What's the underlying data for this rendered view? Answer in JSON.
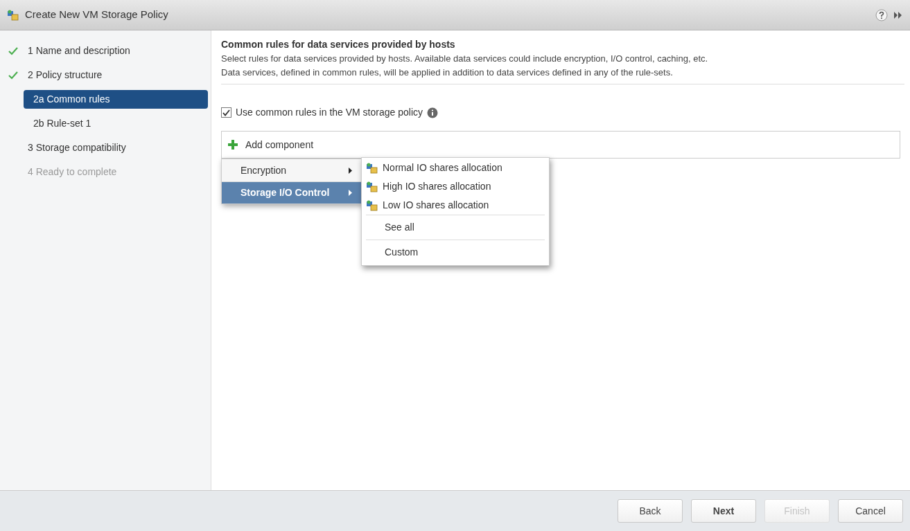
{
  "window": {
    "title": "Create New VM Storage Policy"
  },
  "steps": [
    {
      "label": "1  Name and description",
      "done": true,
      "selected": false,
      "disabled": false
    },
    {
      "label": "2  Policy structure",
      "done": true,
      "selected": false,
      "disabled": false,
      "children": [
        {
          "label": "2a  Common rules",
          "done": false,
          "selected": true,
          "disabled": false
        },
        {
          "label": "2b  Rule-set 1",
          "done": false,
          "selected": false,
          "disabled": false
        }
      ]
    },
    {
      "label": "3  Storage compatibility",
      "done": false,
      "selected": false,
      "disabled": false
    },
    {
      "label": "4  Ready to complete",
      "done": false,
      "selected": false,
      "disabled": true
    }
  ],
  "content": {
    "heading": "Common rules for data services provided by hosts",
    "description": [
      "Select rules for data services provided by hosts. Available data services could include encryption, I/O control, caching, etc.",
      "Data services, defined in common rules, will be applied in addition to data services defined in any of the rule-sets."
    ],
    "checkbox": {
      "label": "Use common rules in the VM storage policy",
      "checked": true
    },
    "add_component": "Add component"
  },
  "menu": [
    {
      "label": "Encryption",
      "selected": false
    },
    {
      "label": "Storage I/O Control",
      "selected": true
    }
  ],
  "submenu": [
    {
      "label": "Normal IO shares allocation",
      "kind": "icon"
    },
    {
      "label": "High IO shares allocation",
      "kind": "icon"
    },
    {
      "label": "Low IO shares allocation",
      "kind": "icon"
    },
    {
      "label": "See all",
      "kind": "plain"
    },
    {
      "label": "Custom",
      "kind": "plain"
    }
  ],
  "buttons": [
    {
      "label": "Back",
      "primary": false,
      "disabled": false
    },
    {
      "label": "Next",
      "primary": true,
      "disabled": false
    },
    {
      "label": "Finish",
      "primary": false,
      "disabled": true
    },
    {
      "label": "Cancel",
      "primary": false,
      "disabled": false
    }
  ]
}
